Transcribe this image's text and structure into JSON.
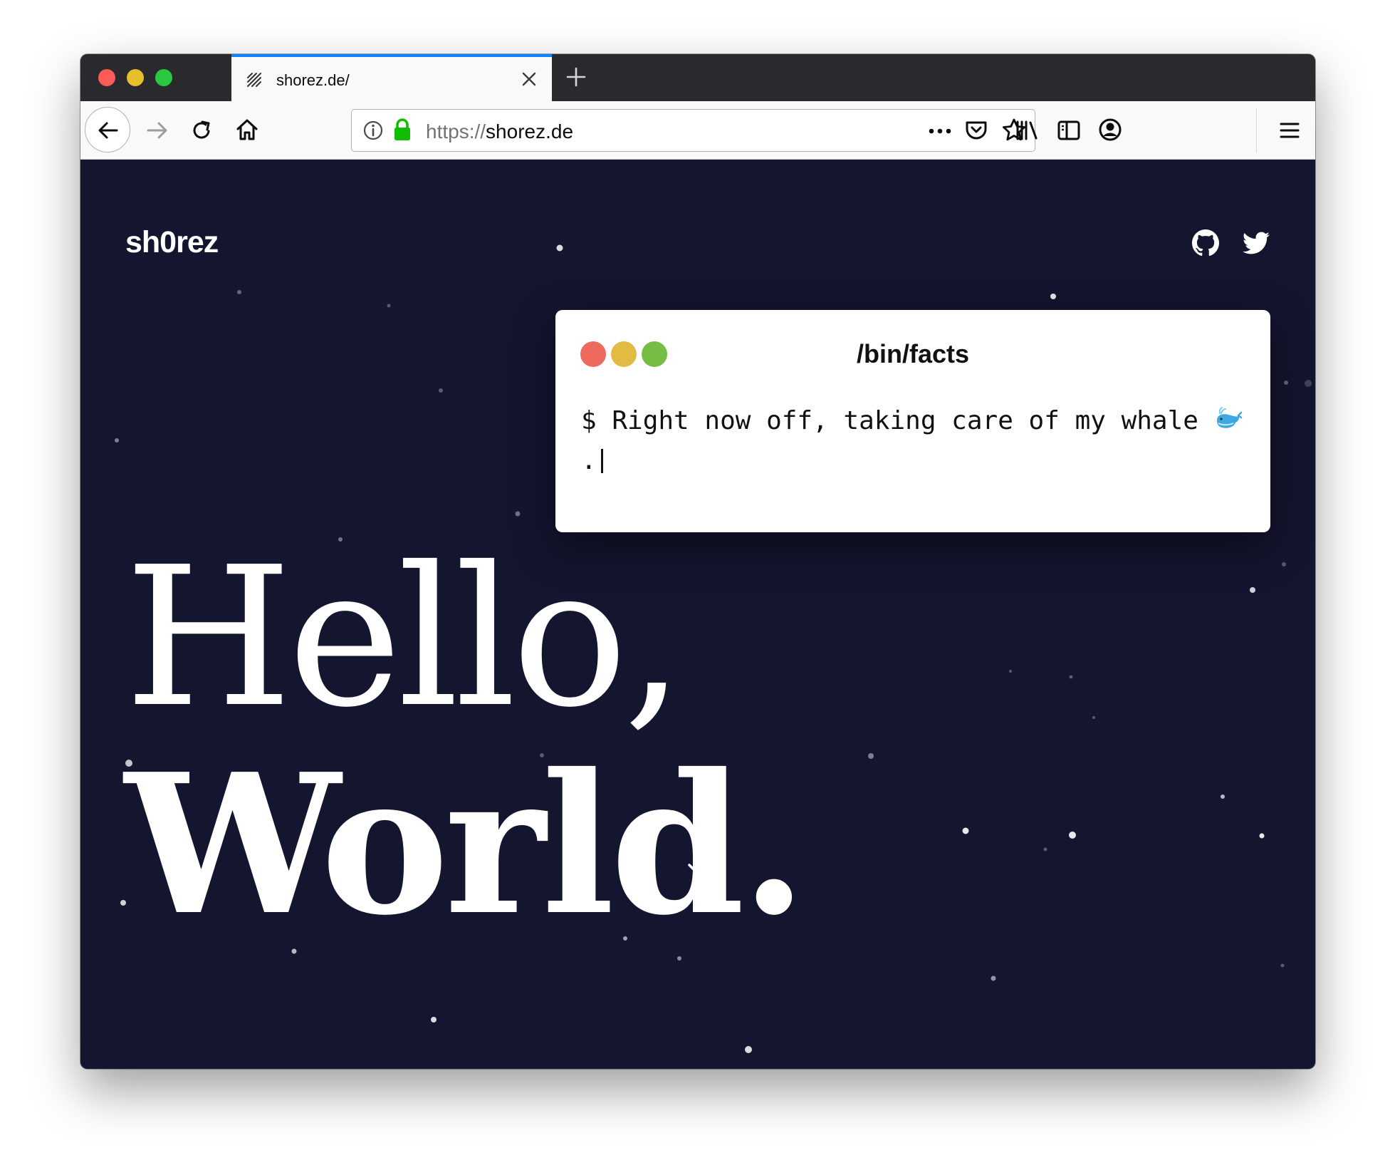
{
  "browser": {
    "tab_title": "shorez.de/",
    "url_scheme": "https://",
    "url_host": "shorez.de",
    "accent_color": "#0a84ff"
  },
  "page": {
    "logo": "sh0rez",
    "terminal": {
      "title": "/bin/facts",
      "text": "$ Right now off, taking care of my whale ",
      "emoji": "whale-emoji",
      "text_after": "."
    },
    "headline_line1": "Hello,",
    "headline_line2": "World.",
    "background_color": "#14152f",
    "icons": [
      "github-icon",
      "twitter-icon",
      "chevron-down-icon"
    ]
  }
}
